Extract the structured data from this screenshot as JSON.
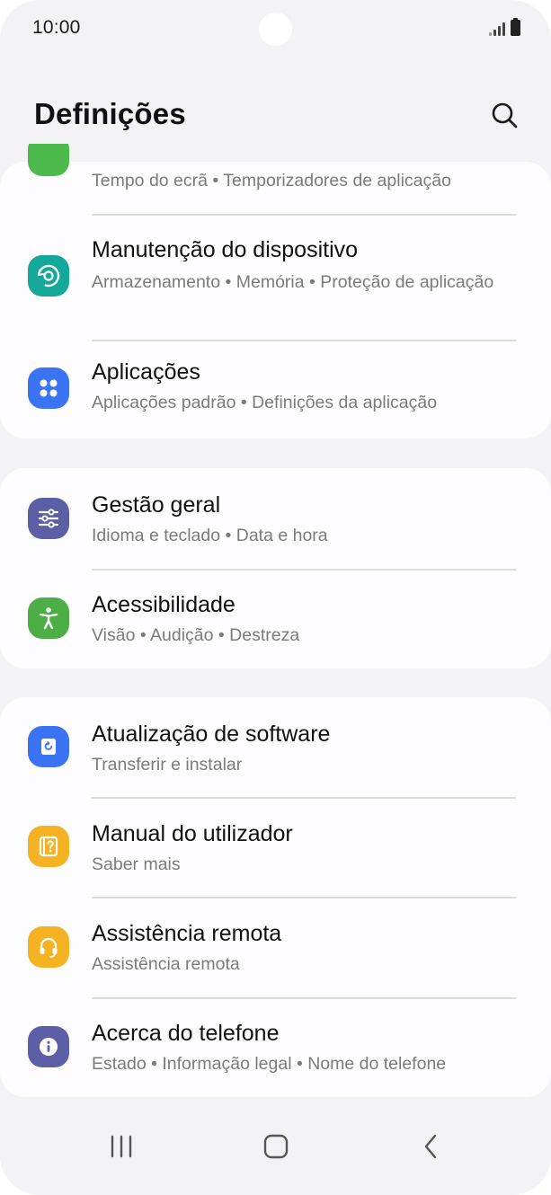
{
  "status_bar": {
    "time": "10:00"
  },
  "header": {
    "title": "Definições",
    "search_icon": "search-icon"
  },
  "items": [
    {
      "id": "screen-time",
      "title": "",
      "subtitle": "Tempo do ecrã  •  Temporizadores de aplicação",
      "icon": "screen-time-icon",
      "color": "#4cba4c"
    },
    {
      "id": "device-care",
      "title": "Manutenção do dispositivo",
      "subtitle": "Armazenamento  •  Memória  •  Proteção de aplicação",
      "icon": "device-care-icon",
      "color": "#14a89a"
    },
    {
      "id": "apps",
      "title": "Aplicações",
      "subtitle": "Aplicações padrão  •  Definições da aplicação",
      "icon": "apps-icon",
      "color": "#3b74f2"
    },
    {
      "id": "general-management",
      "title": "Gestão geral",
      "subtitle": "Idioma e teclado  •  Data e hora",
      "icon": "sliders-icon",
      "color": "#5d5fa6"
    },
    {
      "id": "accessibility",
      "title": "Acessibilidade",
      "subtitle": "Visão  •  Audição  •  Destreza",
      "icon": "accessibility-icon",
      "color": "#4cae44"
    },
    {
      "id": "software-update",
      "title": "Atualização de software",
      "subtitle": "Transferir e instalar",
      "icon": "software-update-icon",
      "color": "#3b74f2"
    },
    {
      "id": "user-manual",
      "title": "Manual do utilizador",
      "subtitle": "Saber mais",
      "icon": "user-manual-icon",
      "color": "#f5b324"
    },
    {
      "id": "remote-support",
      "title": "Assistência remota",
      "subtitle": "Assistência remota",
      "icon": "headset-icon",
      "color": "#f5b324"
    },
    {
      "id": "about-phone",
      "title": "Acerca do telefone",
      "subtitle": "Estado  •  Informação legal  •  Nome do telefone",
      "icon": "info-icon",
      "color": "#5d5fa6"
    }
  ],
  "nav_bar": {
    "recents_icon": "recents-icon",
    "home_icon": "home-icon",
    "back_icon": "back-icon"
  }
}
